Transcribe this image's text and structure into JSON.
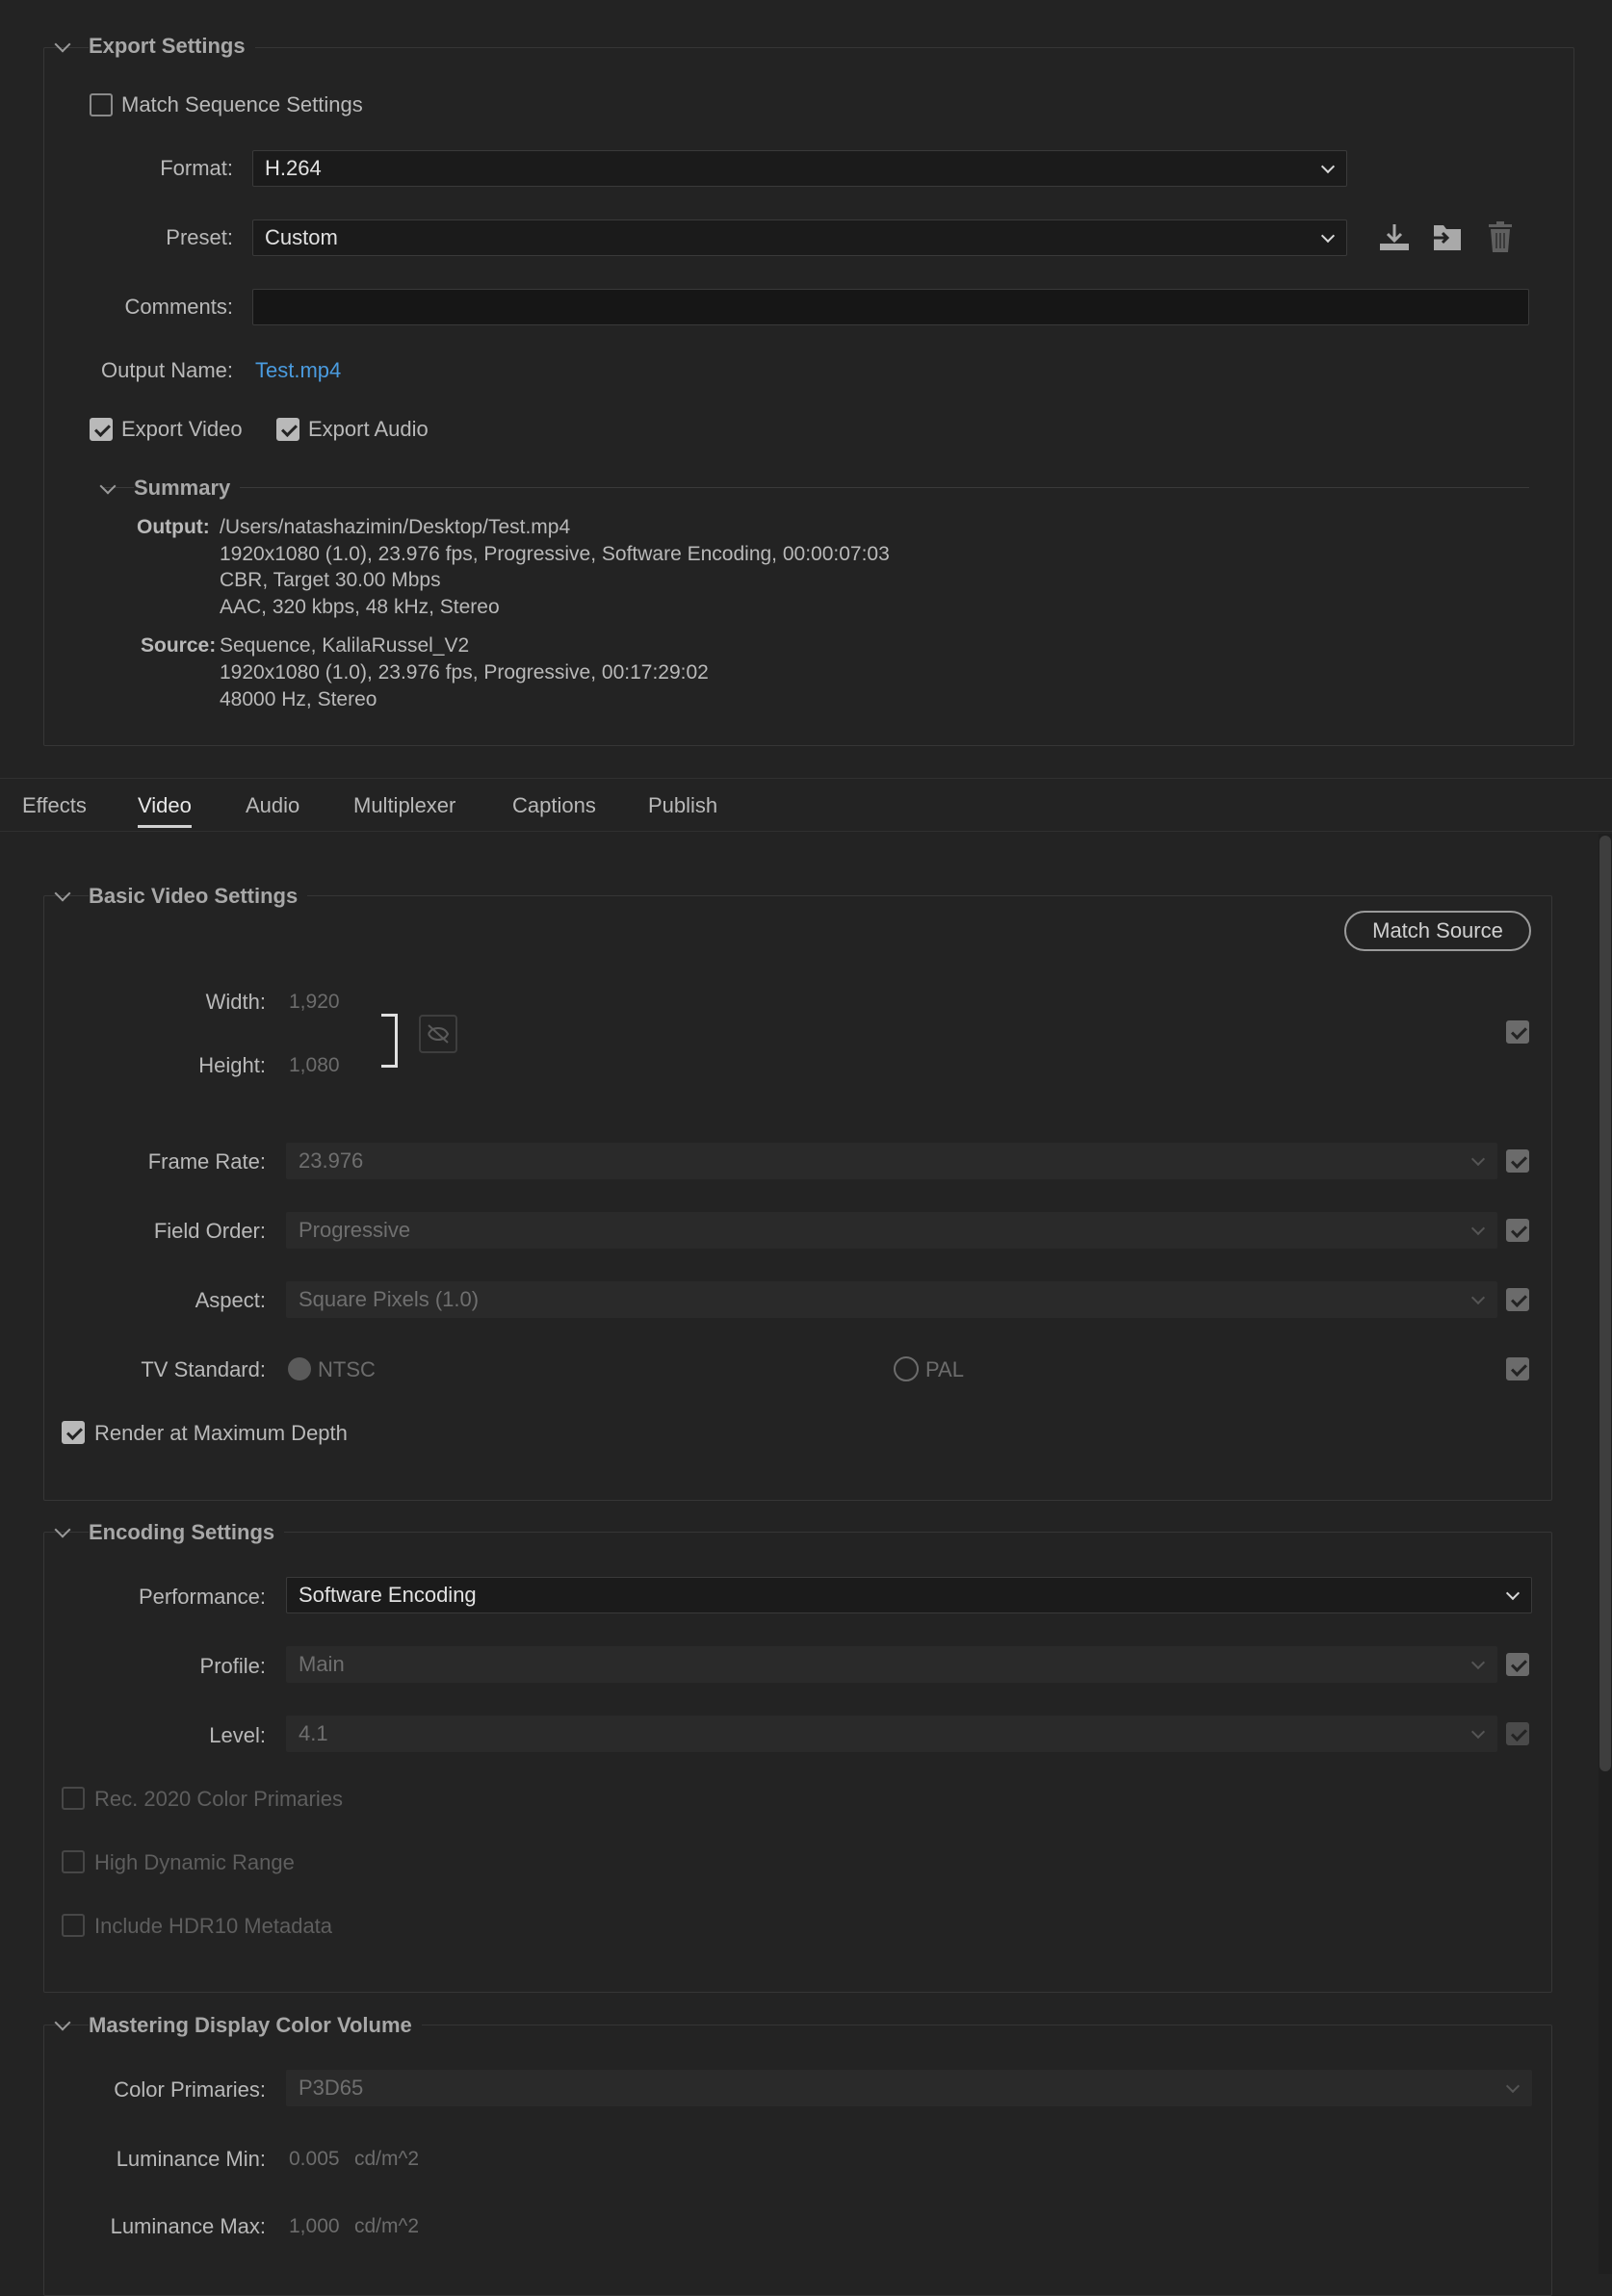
{
  "export_settings": {
    "title": "Export Settings",
    "match_sequence": {
      "label": "Match Sequence Settings",
      "checked": false
    },
    "format_label": "Format:",
    "format_value": "H.264",
    "preset_label": "Preset:",
    "preset_value": "Custom",
    "comments_label": "Comments:",
    "comments_value": "",
    "output_name_label": "Output Name:",
    "output_name_value": "Test.mp4",
    "export_video": {
      "label": "Export Video",
      "checked": true
    },
    "export_audio": {
      "label": "Export Audio",
      "checked": true
    },
    "summary": {
      "title": "Summary",
      "output_label": "Output:",
      "output_lines": [
        "/Users/natashazimin/Desktop/Test.mp4",
        "1920x1080 (1.0), 23.976 fps, Progressive, Software Encoding, 00:00:07:03",
        "CBR, Target 30.00 Mbps",
        "AAC, 320 kbps, 48 kHz, Stereo"
      ],
      "source_label": "Source:",
      "source_lines": [
        "Sequence, KalilaRussel_V2",
        "1920x1080 (1.0), 23.976 fps, Progressive, 00:17:29:02",
        "48000 Hz, Stereo"
      ]
    }
  },
  "tabs": [
    "Effects",
    "Video",
    "Audio",
    "Multiplexer",
    "Captions",
    "Publish"
  ],
  "active_tab": "Video",
  "basic_video": {
    "title": "Basic Video Settings",
    "match_source": "Match Source",
    "width_label": "Width:",
    "width_value": "1,920",
    "height_label": "Height:",
    "height_value": "1,080",
    "frame_rate_label": "Frame Rate:",
    "frame_rate_value": "23.976",
    "field_order_label": "Field Order:",
    "field_order_value": "Progressive",
    "aspect_label": "Aspect:",
    "aspect_value": "Square Pixels (1.0)",
    "tv_standard_label": "TV Standard:",
    "ntsc": "NTSC",
    "pal": "PAL",
    "render_max_depth": {
      "label": "Render at Maximum Depth",
      "checked": true
    }
  },
  "encoding": {
    "title": "Encoding Settings",
    "performance_label": "Performance:",
    "performance_value": "Software Encoding",
    "profile_label": "Profile:",
    "profile_value": "Main",
    "level_label": "Level:",
    "level_value": "4.1",
    "rec2020": "Rec. 2020 Color Primaries",
    "hdr": "High Dynamic Range",
    "hdr10": "Include HDR10 Metadata"
  },
  "mastering": {
    "title": "Mastering Display Color Volume",
    "color_primaries_label": "Color Primaries:",
    "color_primaries_value": "P3D65",
    "lum_min_label": "Luminance Min:",
    "lum_min_value": "0.005",
    "lum_min_unit": "cd/m^2",
    "lum_max_label": "Luminance Max:",
    "lum_max_value": "1,000",
    "lum_max_unit": "cd/m^2"
  },
  "colors": {
    "link": "#4a9bdf",
    "background": "#232323"
  },
  "icons": [
    "save-preset-icon",
    "import-preset-icon",
    "delete-preset-icon",
    "link-off-icon"
  ]
}
